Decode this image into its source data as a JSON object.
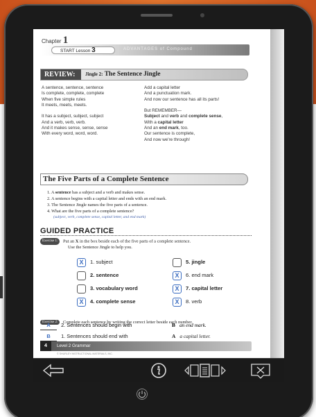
{
  "chapter": {
    "label": "Chapter",
    "number": "1"
  },
  "lesson": {
    "label": "START Lesson",
    "number": "3",
    "deco": "ADVANTAGES of Compound"
  },
  "review": {
    "tag": "REVIEW:",
    "title_prefix": "Jingle 2:",
    "title": "The Sentence Jingle"
  },
  "jingle_left": [
    "A sentence, sentence, sentence",
    "Is complete, complete, complete",
    "When five simple rules",
    "It meets, meets, meets.",
    "",
    "It has a subject, subject, subject",
    "And a verb, verb, verb.",
    "And it makes sense, sense, sense",
    "With every word, word, word."
  ],
  "jingle_right": [
    {
      "text": "Add a capital letter"
    },
    {
      "text": "And a punctuation mark."
    },
    {
      "text": "And now our sentence has all its parts!"
    },
    {
      "text": ""
    },
    {
      "text": "But REMEMBER—"
    },
    {
      "pre": "",
      "b1": "Subject",
      "mid": " and ",
      "b2": "verb",
      "mid2": " and ",
      "b3": "complete sense",
      "post": ","
    },
    {
      "pre": "With a ",
      "b1": "capital letter",
      "mid": "",
      "b2": "",
      "mid2": "",
      "b3": "",
      "post": ""
    },
    {
      "pre": "And an ",
      "b1": "end mark",
      "mid": ", too.",
      "b2": "",
      "mid2": "",
      "b3": "",
      "post": ""
    },
    {
      "text": "Our sentence is complete,"
    },
    {
      "text": "And now we're through!"
    }
  ],
  "five_parts": {
    "heading": "The Five Parts of a Complete Sentence",
    "items": [
      {
        "pre": "1. A ",
        "bold": "sentence",
        "post": " has a subject and a verb and makes sense."
      },
      {
        "pre": "2. A sentence begins with a capital letter and ends with an end mark.",
        "bold": "",
        "post": ""
      },
      {
        "pre": "3. The Sentence Jingle names the five parts of a sentence.",
        "bold": "",
        "post": ""
      },
      {
        "pre": "4. What are the five parts of a complete sentence?",
        "bold": "",
        "post": ""
      }
    ],
    "note": "(subject, verb, complete sense, capital letter, and end mark)"
  },
  "guided": {
    "heading": "GUIDED PRACTICE"
  },
  "exercise1": {
    "badge": "Exercise 1:",
    "line1_pre": "Put an ",
    "line1_bold": "X",
    "line1_post": " in the box beside each of the five parts of a complete sentence.",
    "line2": "Use the Sentence Jingle to help you."
  },
  "checkboxes": [
    {
      "mark": "X",
      "label": "1. subject",
      "bold": false
    },
    {
      "mark": "",
      "label": "2. sentence",
      "bold": true
    },
    {
      "mark": "",
      "label": "3. vocabulary word",
      "bold": true
    },
    {
      "mark": "X",
      "label": "4. complete sense",
      "bold": true
    },
    {
      "mark": "",
      "label": "5. jingle",
      "bold": true
    },
    {
      "mark": "X",
      "label": "6. end mark",
      "bold": false
    },
    {
      "mark": "X",
      "label": "7. capital letter",
      "bold": true
    },
    {
      "mark": "X",
      "label": "8. verb",
      "bold": false
    }
  ],
  "exercise2": {
    "badge": "Exercise 2:",
    "text": "Complete each sentence by writing the correct letter beside each number."
  },
  "answers": [
    {
      "blank": "B",
      "text": "1. Sentences should end with",
      "letter": "A",
      "choice": "a capital letter."
    },
    {
      "blank": "A",
      "text": "2. Sentences should begin with",
      "letter": "B",
      "choice": "an end mark."
    }
  ],
  "footer": {
    "page": "4",
    "label": "Level 2 Grammar",
    "copyright": "© SHURLEY INSTRUCTIONAL MATERIALS, INC."
  },
  "toolbar": {
    "back": "back-arrow-icon",
    "info": "info-icon",
    "pages": "page-view-icon",
    "close": "close-icon"
  },
  "colors": {
    "accent": "#3a6cc0",
    "orange": "#e0742e",
    "bezel": "#1b1b1b"
  }
}
